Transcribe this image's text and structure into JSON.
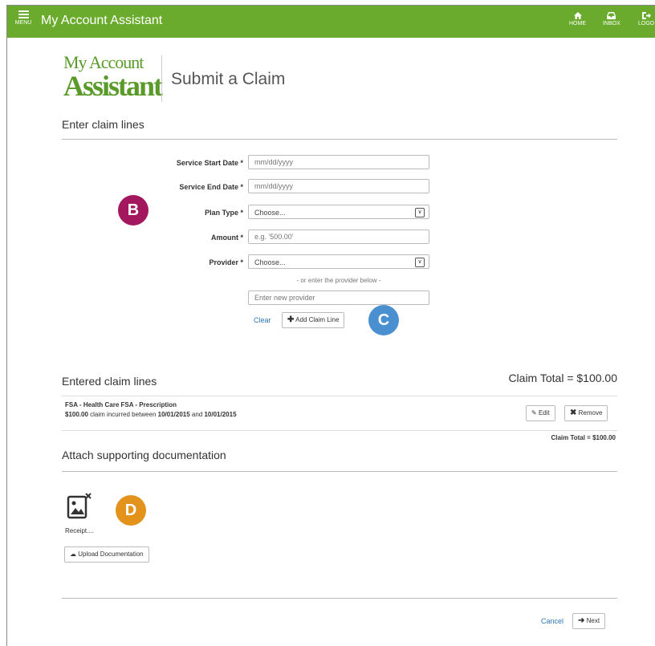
{
  "header": {
    "menu_label": "MENU",
    "app_title": "My Account Assistant",
    "nav": [
      {
        "label": "HOME",
        "icon": "home-icon"
      },
      {
        "label": "INBOX",
        "icon": "inbox-icon"
      },
      {
        "label": "LOGO",
        "icon": "logout-icon"
      }
    ],
    "bar_color": "#6aab2e"
  },
  "logo": {
    "line1": "My Account",
    "line2": "Assistant"
  },
  "page_title": "Submit a Claim",
  "enter_section": {
    "heading": "Enter claim lines",
    "fields": {
      "start_date": {
        "label": "Service Start Date",
        "placeholder": "mm/dd/yyyy"
      },
      "end_date": {
        "label": "Service End Date",
        "placeholder": "mm/dd/yyyy"
      },
      "plan_type": {
        "label": "Plan Type",
        "value": "Choose..."
      },
      "amount": {
        "label": "Amount",
        "placeholder": "e.g. '500.00'"
      },
      "provider": {
        "label": "Provider",
        "value": "Choose..."
      },
      "required_mark": "*"
    },
    "or_text": "- or enter the provider below -",
    "new_provider_placeholder": "Enter new provider",
    "clear_label": "Clear",
    "add_line_label": "Add Claim Line"
  },
  "badges": {
    "b": {
      "label": "B",
      "color": "#a3175e"
    },
    "c": {
      "label": "C",
      "color": "#4a8fcf"
    },
    "d": {
      "label": "D",
      "color": "#e3931b"
    }
  },
  "entered_section": {
    "heading": "Entered claim lines",
    "total_top": "Claim Total = $100.00",
    "lines": [
      {
        "title": "FSA - Health Care FSA - Prescription",
        "amount": "$100.00",
        "text_mid": " claim incurred between ",
        "start": "10/01/2015",
        "text_and": " and ",
        "end": "10/01/2015"
      }
    ],
    "edit_label": "Edit",
    "remove_label": "Remove",
    "total_bottom": "Claim Total = $100.00"
  },
  "attach_section": {
    "heading": "Attach supporting documentation",
    "file_label": "Receipt....",
    "upload_label": "Upload Documentation"
  },
  "footer": {
    "cancel_label": "Cancel",
    "next_label": "Next"
  }
}
